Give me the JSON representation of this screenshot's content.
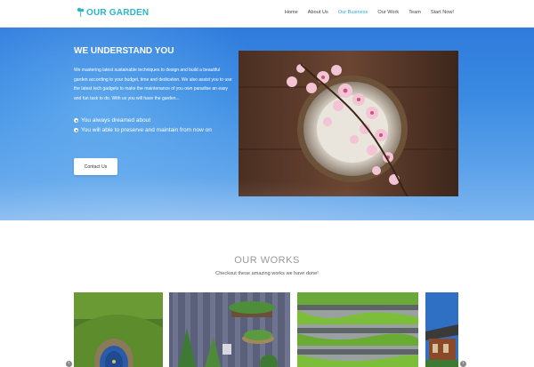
{
  "brand": {
    "name": "OUR GARDEN",
    "icon": "leaf-icon",
    "color": "#2bb5c8"
  },
  "nav": {
    "items": [
      {
        "label": "Home",
        "active": false
      },
      {
        "label": "About Us",
        "active": false
      },
      {
        "label": "Our Business",
        "active": true
      },
      {
        "label": "Our Work",
        "active": false
      },
      {
        "label": "Team",
        "active": false
      },
      {
        "label": "Start Now!",
        "active": false
      }
    ]
  },
  "hero": {
    "title": "WE UNDERSTAND YOU",
    "description": "We mastering latest sustainable techniques to design and build a beautiful garden according to your budget, time and dedication. We also assist you to use the latest tech gadgets to make the maintenance of you own paradise an easy and fun task to do. With us you will have the garden...",
    "bullets": [
      "You always dreamed about",
      "You will able to preserve and maintain from now on"
    ],
    "button_label": "Contact Us"
  },
  "works": {
    "title": "OUR WORKS",
    "subtitle": "Checkout these amazing works we have done!",
    "prev_icon": "chevron-left-icon",
    "next_icon": "chevron-right-icon"
  },
  "colors": {
    "accent": "#2aa7d6",
    "hero_top": "#2f7bdc",
    "hero_bottom": "#7fb6ef"
  }
}
